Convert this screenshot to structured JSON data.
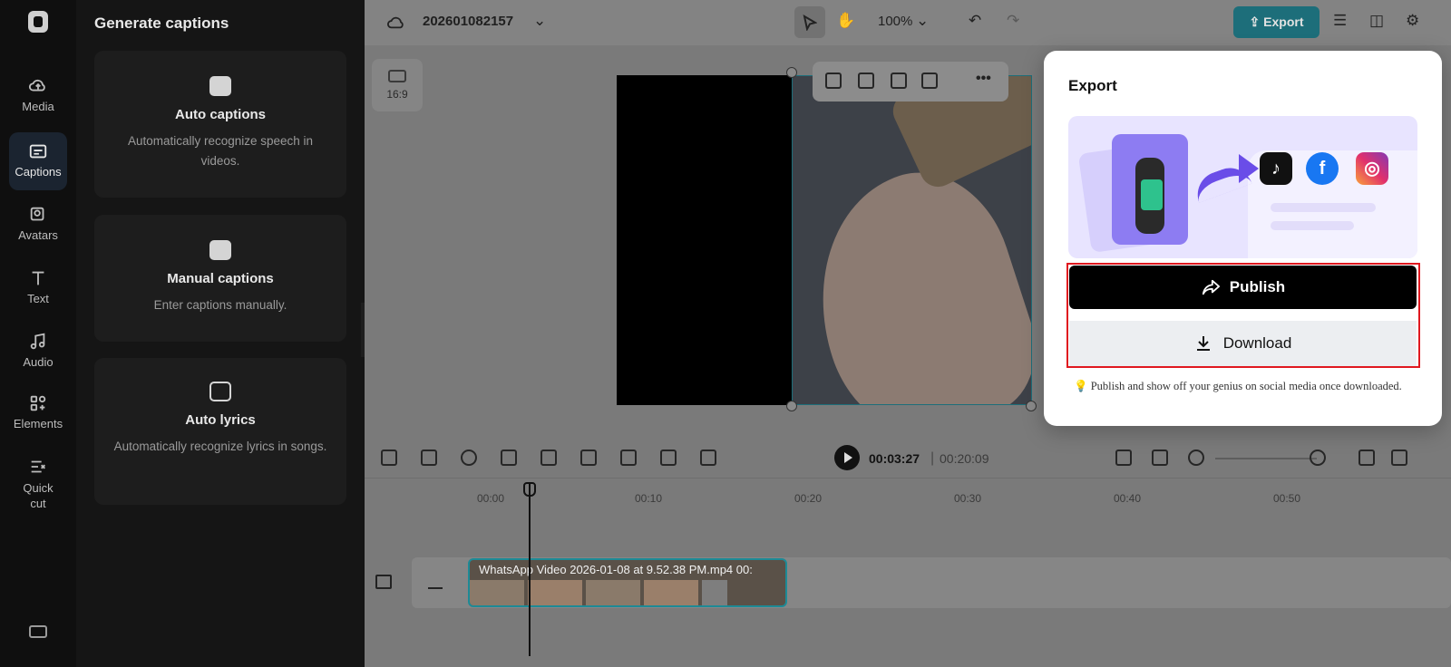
{
  "rail": {
    "items": [
      {
        "label": "Media",
        "icon": "cloud-upload-icon"
      },
      {
        "label": "Captions",
        "icon": "captions-icon"
      },
      {
        "label": "Avatars",
        "icon": "avatar-icon"
      },
      {
        "label": "Text",
        "icon": "text-icon"
      },
      {
        "label": "Audio",
        "icon": "music-note-icon"
      },
      {
        "label": "Elements",
        "icon": "elements-icon"
      },
      {
        "label": "Quick cut",
        "icon": "quick-cut-icon"
      }
    ]
  },
  "panel": {
    "title": "Generate captions",
    "cards": [
      {
        "title": "Auto captions",
        "desc": "Automatically recognize speech in videos."
      },
      {
        "title": "Manual captions",
        "desc": "Enter captions manually."
      },
      {
        "title": "Auto lyrics",
        "desc": "Automatically recognize lyrics in songs."
      }
    ]
  },
  "topbar": {
    "project_name": "202601082157",
    "zoom": "100%",
    "export_label": "Export"
  },
  "canvas": {
    "ratio_label": "16:9"
  },
  "playback": {
    "current_time": "00:03:27",
    "separator": "|",
    "total_time": "00:20:09"
  },
  "ruler": [
    "00:00",
    "00:10",
    "00:20",
    "00:30",
    "00:40",
    "00:50"
  ],
  "clip": {
    "label": "WhatsApp Video 2026-01-08 at 9.52.38 PM.mp4   00:"
  },
  "export_popup": {
    "title": "Export",
    "publish_label": "Publish",
    "download_label": "Download",
    "hint": "💡 Publish and show off your genius on social media once downloaded.",
    "social": [
      "TikTok",
      "Facebook",
      "Instagram"
    ]
  },
  "colors": {
    "accent": "#1d6e7a",
    "highlight": "#e0181f",
    "publish_bg": "#000000"
  }
}
